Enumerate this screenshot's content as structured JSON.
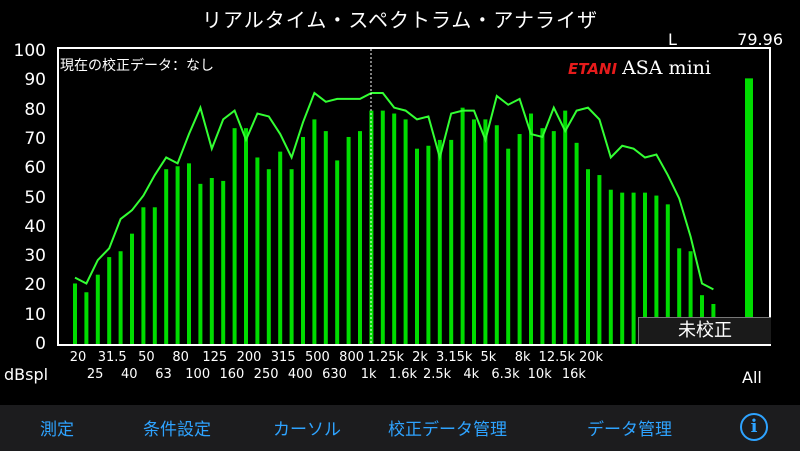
{
  "header": {
    "title": "リアルタイム・スペクトラム・アナライザ"
  },
  "level": {
    "channel": "L",
    "value": "79.96"
  },
  "calibration_label": "現在の校正データ：なし",
  "logo": {
    "brand": "ETANI",
    "model": "ASA mini"
  },
  "uncalibrated_badge": "未校正",
  "toolbar": {
    "measure": "測定",
    "conditions": "条件設定",
    "cursor": "カーソル",
    "calibration_mgmt": "校正データ管理",
    "data_mgmt": "データ管理",
    "info_icon": "info-icon"
  },
  "colors": {
    "bars": "#00dd00",
    "line": "#33ff33",
    "accent": "#2ea3ff",
    "logo_red": "#e51b1b"
  },
  "chart_data": {
    "type": "bar",
    "ylabel": "dBspl",
    "ylim": [
      0,
      100
    ],
    "yticks": [
      "0",
      "10",
      "20",
      "30",
      "40",
      "50",
      "60",
      "70",
      "80",
      "90",
      "100"
    ],
    "xticks_top": [
      "20",
      "31.5",
      "50",
      "80",
      "125",
      "200",
      "315",
      "500",
      "800",
      "1.25k",
      "2k",
      "3.15k",
      "5k",
      "8k",
      "12.5k",
      "20k"
    ],
    "xticks_bottom": [
      "25",
      "40",
      "63",
      "100",
      "160",
      "250",
      "400",
      "630",
      "1k",
      "1.6k",
      "2.5k",
      "4k",
      "6.3k",
      "10k",
      "16k"
    ],
    "all_label": "All",
    "bar_values": [
      21,
      18,
      24,
      30,
      32,
      38,
      47,
      47,
      60,
      61,
      62,
      55,
      57,
      56,
      74,
      74,
      64,
      60,
      66,
      60,
      71,
      77,
      73,
      63,
      71,
      73,
      80,
      80,
      79,
      77,
      67,
      68,
      70,
      70,
      81,
      77,
      77,
      75,
      67,
      72,
      79,
      74,
      73,
      80,
      69,
      60,
      58,
      53,
      52,
      52,
      52,
      51,
      48,
      33,
      32,
      17,
      14
    ],
    "line_values": [
      23,
      21,
      29,
      33,
      43,
      46,
      51,
      58,
      64,
      62,
      72,
      81,
      67,
      77,
      80,
      70,
      79,
      78,
      72,
      64,
      76,
      86,
      83,
      84,
      84,
      84,
      86,
      86,
      81,
      80,
      77,
      78,
      64,
      79,
      80,
      80,
      70,
      85,
      82,
      84,
      72,
      71,
      81,
      73,
      80,
      81,
      77,
      64,
      68,
      67,
      64,
      65,
      58,
      50,
      37,
      21,
      19
    ],
    "overall_value": 91
  }
}
